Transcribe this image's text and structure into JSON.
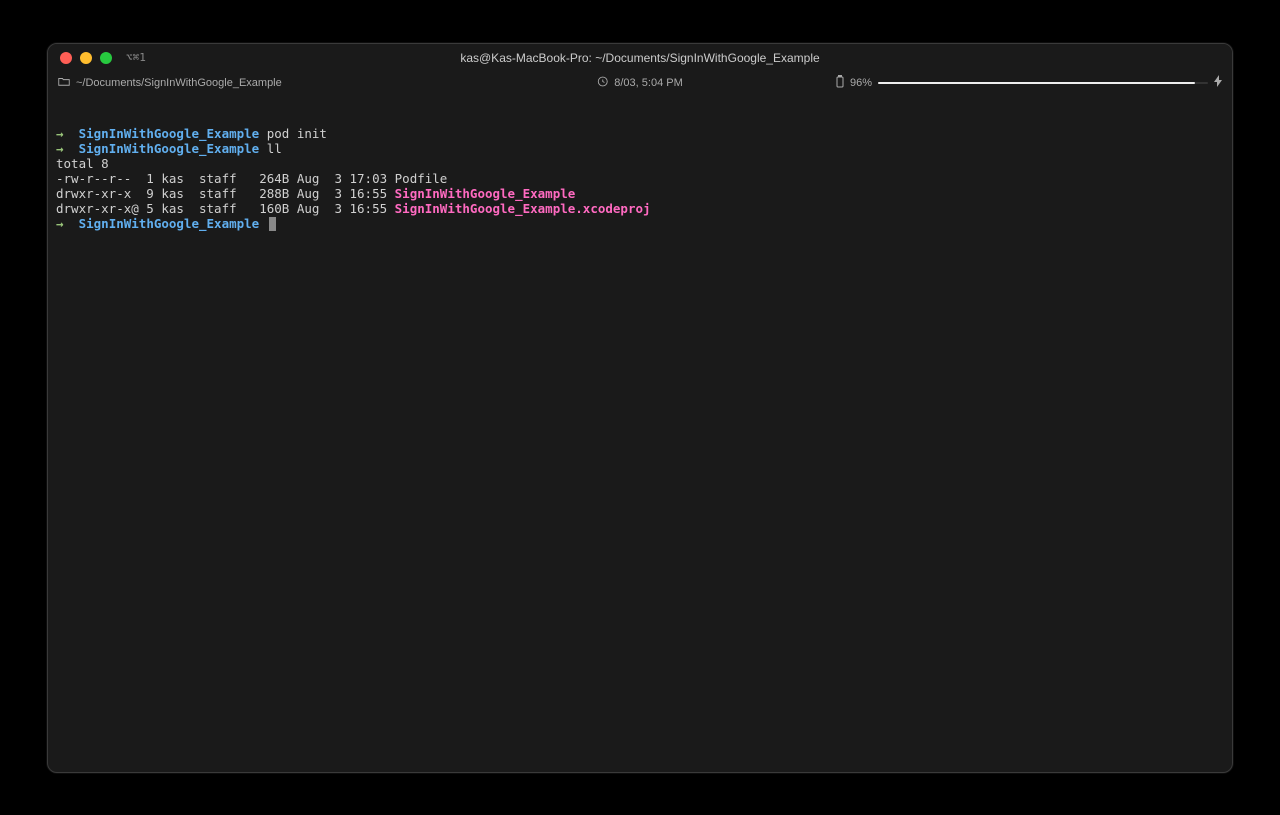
{
  "titlebar": {
    "tab_label": "⌥⌘1",
    "title": "kas@Kas-MacBook-Pro: ~/Documents/SignInWithGoogle_Example"
  },
  "statusbar": {
    "path": "~/Documents/SignInWithGoogle_Example",
    "datetime": "8/03, 5:04 PM",
    "battery_percent": "96%",
    "lightning": "⚡"
  },
  "terminal": {
    "lines": [
      {
        "type": "prompt",
        "arrow": "→",
        "path": "SignInWithGoogle_Example",
        "command": "pod init"
      },
      {
        "type": "prompt",
        "arrow": "→",
        "path": "SignInWithGoogle_Example",
        "command": "ll"
      },
      {
        "type": "output",
        "text": "total 8"
      },
      {
        "type": "ls",
        "perms": "-rw-r--r--  1 kas  staff   264B Aug  3 17:03 ",
        "name": "Podfile",
        "is_dir": false
      },
      {
        "type": "ls",
        "perms": "drwxr-xr-x  9 kas  staff   288B Aug  3 16:55 ",
        "name": "SignInWithGoogle_Example",
        "is_dir": true
      },
      {
        "type": "ls",
        "perms": "drwxr-xr-x@ 5 kas  staff   160B Aug  3 16:55 ",
        "name": "SignInWithGoogle_Example.xcodeproj",
        "is_dir": true
      },
      {
        "type": "prompt",
        "arrow": "→",
        "path": "SignInWithGoogle_Example",
        "command": "",
        "has_cursor": true
      }
    ]
  }
}
